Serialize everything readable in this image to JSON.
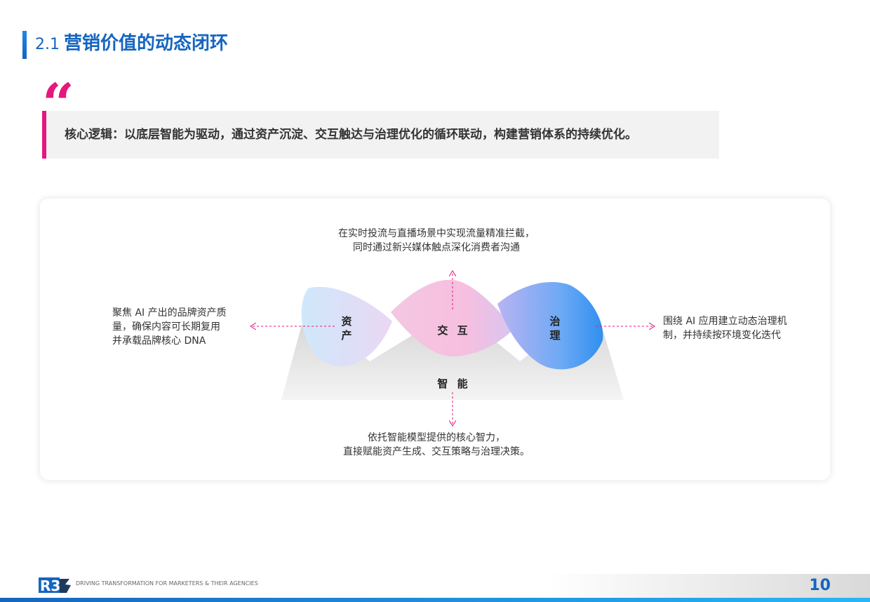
{
  "header": {
    "section_number": "2.1",
    "title": "营销价值的动态闭环"
  },
  "quote": {
    "mark": "“",
    "text": "核心逻辑：以底层智能为驱动，通过资产沉淀、交互触达与治理优化的循环联动，构建营销体系的持续优化。"
  },
  "diagram": {
    "nodes": {
      "asset": "资产",
      "interact": "交 互",
      "govern": "治理",
      "ai": "智 能"
    },
    "descriptions": {
      "top_line1": "在实时投流与直播场景中实现流量精准拦截，",
      "top_line2": "同时通过新兴媒体触点深化消费者沟通",
      "bottom_line1": "依托智能模型提供的核心智力，",
      "bottom_line2": "直接赋能资产生成、交互策略与治理决策。",
      "left_line1": "聚焦 AI 产出的品牌资产质",
      "left_line2": "量，确保内容可长期复用",
      "left_line3": "并承载品牌核心 DNA",
      "right_line1": "围绕 AI 应用建立动态治理机",
      "right_line2": "制，并持续按环境变化迭代"
    },
    "colors": {
      "accent": "#e6177e",
      "blue": "#1565c0"
    }
  },
  "footer": {
    "logo": "R3",
    "tagline": "DRIVING TRANSFORMATION FOR MARKETERS & THEIR AGENCIES",
    "page_number": "10"
  }
}
